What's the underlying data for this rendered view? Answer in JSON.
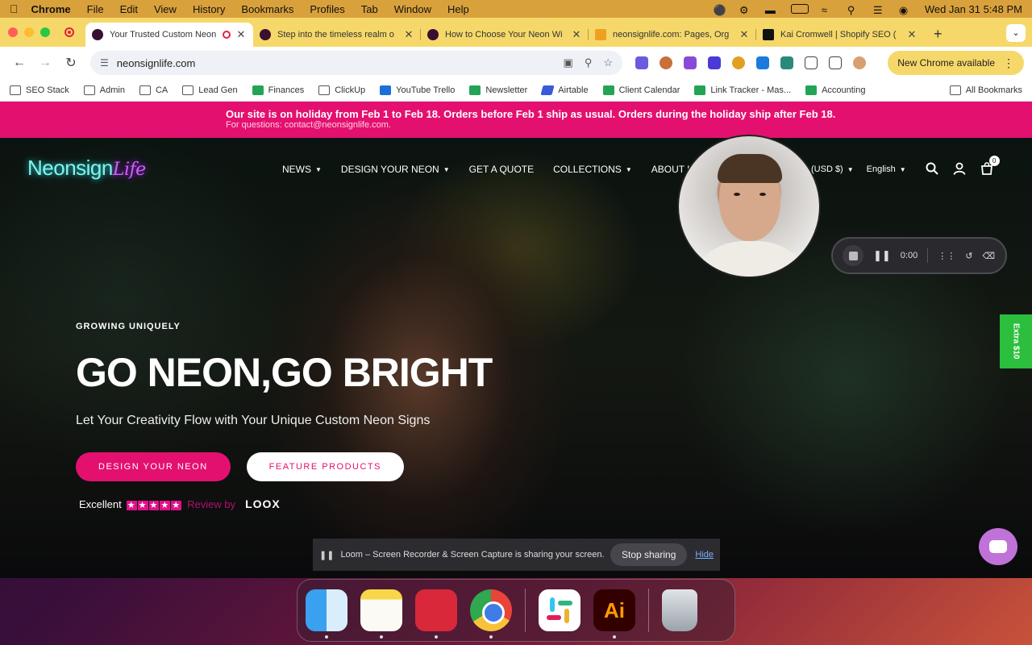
{
  "menubar": {
    "app": "Chrome",
    "items": [
      "File",
      "Edit",
      "View",
      "History",
      "Bookmarks",
      "Profiles",
      "Tab",
      "Window",
      "Help"
    ],
    "clock": "Wed Jan 31  5:48 PM"
  },
  "tabs": [
    {
      "title": "Your Trusted Custom Neon Sig",
      "active": true
    },
    {
      "title": "Step into the timeless realm o",
      "active": false
    },
    {
      "title": "How to Choose Your Neon Wi",
      "active": false
    },
    {
      "title": "neonsignlife.com: Pages, Org",
      "active": false
    },
    {
      "title": "Kai Cromwell | Shopify SEO (",
      "active": false
    }
  ],
  "toolbar": {
    "url": "neonsignlife.com",
    "update_label": "New Chrome available"
  },
  "bookmarks": [
    {
      "label": "SEO Stack",
      "icon": "folder"
    },
    {
      "label": "Admin",
      "icon": "folder"
    },
    {
      "label": "CA",
      "icon": "folder"
    },
    {
      "label": "Lead Gen",
      "icon": "folder"
    },
    {
      "label": "Finances",
      "icon": "sheet"
    },
    {
      "label": "ClickUp",
      "icon": "folder"
    },
    {
      "label": "YouTube Trello",
      "icon": "trello"
    },
    {
      "label": "Newsletter",
      "icon": "sheet"
    },
    {
      "label": "Airtable",
      "icon": "air"
    },
    {
      "label": "Client Calendar",
      "icon": "sheet"
    },
    {
      "label": "Link Tracker - Mas...",
      "icon": "sheet"
    },
    {
      "label": "Accounting",
      "icon": "sheet"
    }
  ],
  "all_bookmarks": "All Bookmarks",
  "announcement": {
    "main": "Our site is on holiday from Feb 1 to Feb 18. Orders before Feb 1 ship as usual. Orders during the holiday ship after Feb 18.",
    "sub": "For questions: contact@neonsignlife.com."
  },
  "site": {
    "logo_main": "Neonsign",
    "logo_accent": "Life",
    "nav": [
      "NEWS",
      "DESIGN YOUR NEON",
      "GET A QUOTE",
      "COLLECTIONS",
      "ABOUT US"
    ],
    "nav_has_dropdown": [
      true,
      true,
      false,
      true,
      false
    ],
    "currency": "(USD $)",
    "language": "English",
    "cart_count": "0"
  },
  "hero": {
    "tagline": "GROWING UNIQUELY",
    "headline": "GO NEON,GO BRIGHT",
    "subline": "Let Your Creativity Flow with Your Unique Custom Neon Signs",
    "cta_primary": "DESIGN YOUR NEON",
    "cta_secondary": "FEATURE PRODUCTS",
    "review_label": "Excellent",
    "review_by": "Review by",
    "review_brand": "LOOX"
  },
  "loom": {
    "timer": "0:00",
    "share_message": "Loom – Screen Recorder & Screen Capture is sharing your screen.",
    "stop_label": "Stop sharing",
    "hide_label": "Hide"
  },
  "extra_tab": "Extra $10",
  "dock": [
    "finder",
    "notes",
    "expressvpn",
    "chrome",
    "slack",
    "illustrator",
    "trash"
  ],
  "colors": {
    "brand_pink": "#e4106f",
    "tab_strip": "#f6d86a",
    "extra_green": "#2bbf3d"
  }
}
